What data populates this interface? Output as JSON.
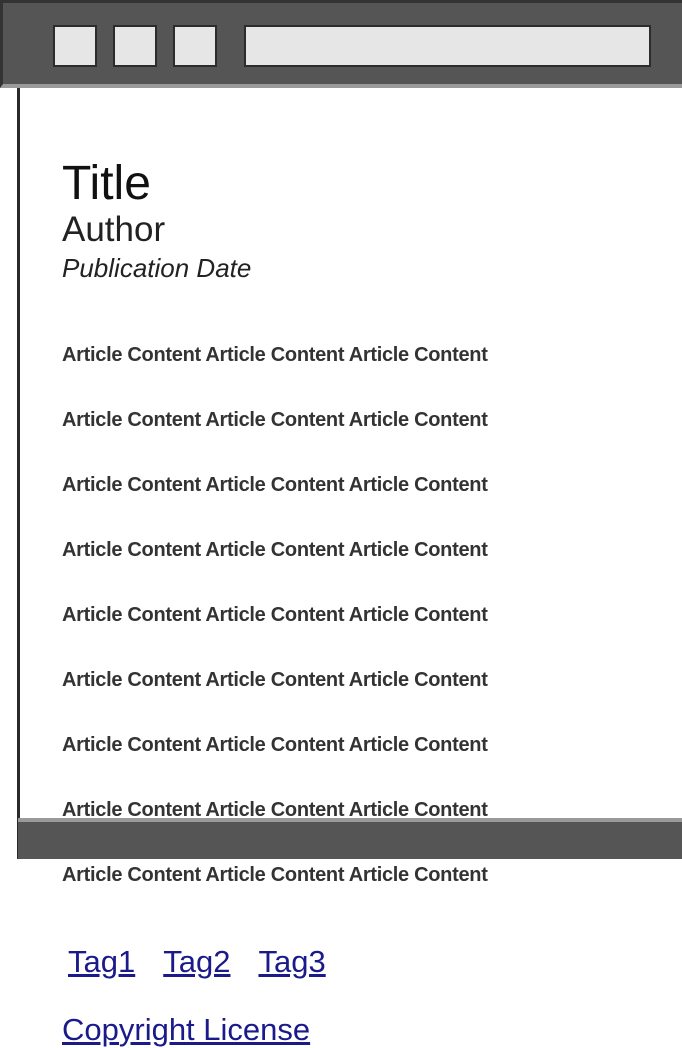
{
  "browser": {
    "window_buttons": [
      "",
      "",
      ""
    ],
    "address": ""
  },
  "article": {
    "title": "Title",
    "author": "Author",
    "publication_date": "Publication Date",
    "content_lines": [
      "Article Content Article Content Article Content",
      "Article Content Article Content Article Content",
      "Article Content Article Content Article Content",
      "Article Content Article Content Article Content",
      "Article Content Article Content Article Content",
      "Article Content Article Content Article Content",
      "Article Content Article Content Article Content",
      "Article Content Article Content Article Content",
      "Article Content Article Content Article Content"
    ],
    "tags": [
      "Tag1",
      "Tag2",
      "Tag3"
    ],
    "license": "Copyright License"
  },
  "colors": {
    "chrome": "#555555",
    "link": "#1a1a8a"
  }
}
